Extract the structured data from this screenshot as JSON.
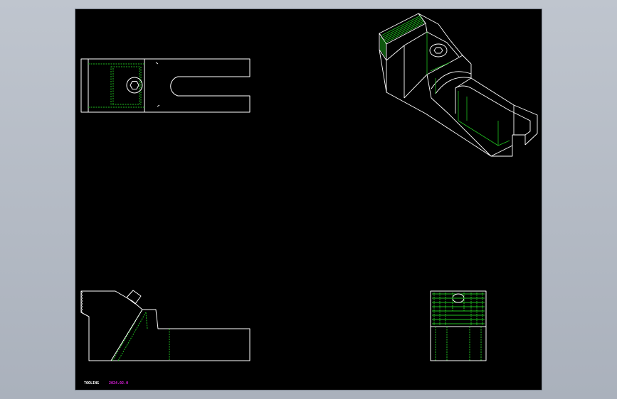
{
  "window": {
    "background": "#b6bcc6"
  },
  "sheet": {
    "background": "#000000",
    "line_color": "#ffffff",
    "hidden_color": "#20c020"
  },
  "views": [
    {
      "name": "top-view"
    },
    {
      "name": "isometric-view"
    },
    {
      "name": "front-view"
    },
    {
      "name": "side-view"
    }
  ],
  "stamp": {
    "left_text": "TOOLING",
    "right_text": "2024.02.0",
    "left_color": "#ffffff",
    "right_color": "#e020e0"
  }
}
